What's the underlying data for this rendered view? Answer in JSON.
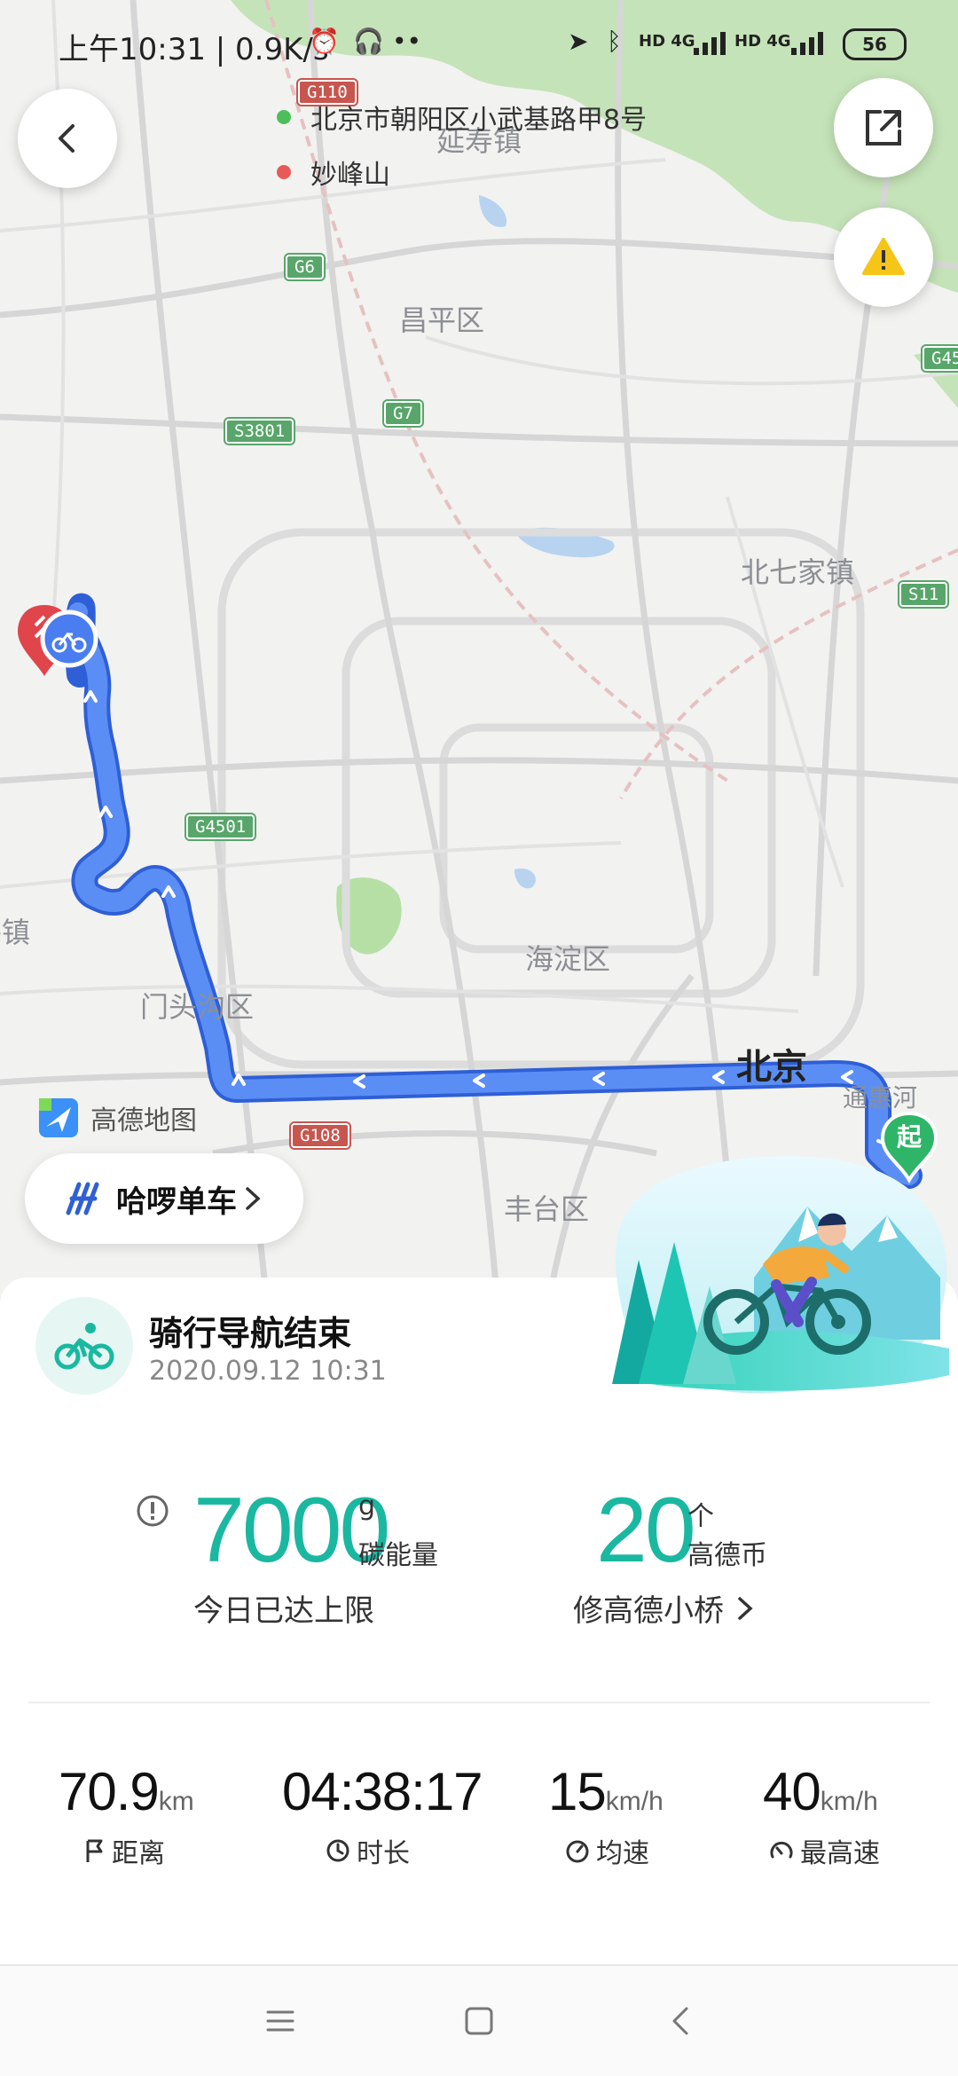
{
  "status_bar": {
    "time_speed": "上午10:31 | 0.9K/s",
    "network_left": "HD 4G",
    "network_right": "HD 4G",
    "battery": "56"
  },
  "route": {
    "origin": "北京市朝阳区小武基路甲8号",
    "destination": "妙峰山"
  },
  "map": {
    "places": [
      "延寿镇",
      "昌平区",
      "北七家镇",
      "海淀区",
      "门头沟区",
      "北京",
      "丰台区",
      "通惠河",
      "平镇"
    ],
    "roads": [
      "G110",
      "G6",
      "G7",
      "S3801",
      "G45",
      "S11",
      "G4501",
      "G108"
    ],
    "start_marker": "起",
    "logo": "高德地图"
  },
  "buttons": {
    "back": "back",
    "share": "share",
    "report": "report",
    "hello_bike": "哈啰单车"
  },
  "result": {
    "title": "骑行导航结束",
    "datetime": "2020.09.12 10:31",
    "carbon_value": "7000",
    "carbon_unit": "g",
    "carbon_label": "碳能量",
    "carbon_note": "今日已达上限",
    "coin_value": "20",
    "coin_unit": "个",
    "coin_label": "高德币",
    "coin_action": "修高德小桥"
  },
  "stats": [
    {
      "value": "70.9",
      "unit": "km",
      "label": "距离",
      "icon": "flag-icon"
    },
    {
      "value": "04:38:17",
      "unit": "",
      "label": "时长",
      "icon": "clock-icon"
    },
    {
      "value": "15",
      "unit": "km/h",
      "label": "均速",
      "icon": "speed-icon"
    },
    {
      "value": "40",
      "unit": "km/h",
      "label": "最高速",
      "icon": "gauge-icon"
    }
  ],
  "colors": {
    "accent": "#1ab8a0",
    "route": "#4a7df0",
    "origin_dot": "#4cbf5a",
    "dest_dot": "#e85a5a",
    "warning": "#f5c518"
  }
}
